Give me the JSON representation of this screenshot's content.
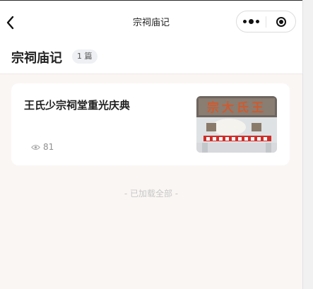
{
  "navbar": {
    "title": "宗祠庙记",
    "back_icon": "chevron-left-icon",
    "more_icon": "more-dots-icon",
    "close_icon": "target-circle-icon"
  },
  "header": {
    "title": "宗祠庙记",
    "count_badge": "1 篇"
  },
  "articles": [
    {
      "title": "王氏少宗祠堂重光庆典",
      "views": "81",
      "view_icon": "eye-icon",
      "thumbnail_text": "宗大氏王"
    }
  ],
  "footer": {
    "end_text": "- 已加载全部 -"
  },
  "colors": {
    "page_background": "#faf6f4",
    "card_background": "#ffffff",
    "badge_background": "#eef0f3",
    "muted_text": "#c8c8c8"
  }
}
